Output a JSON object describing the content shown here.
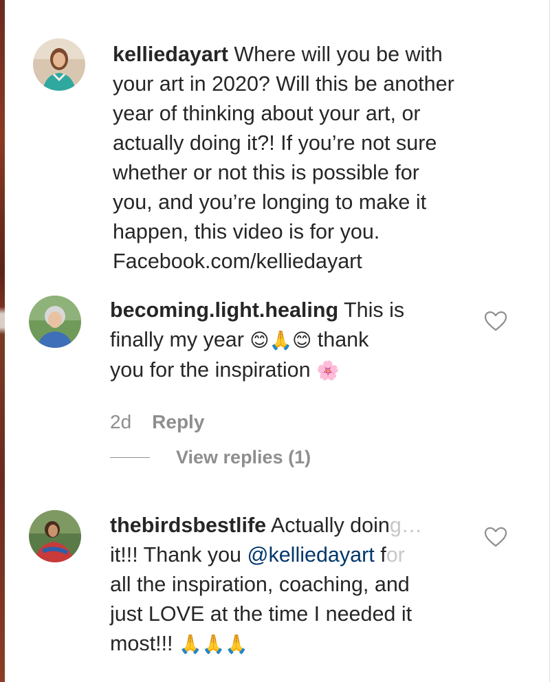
{
  "comments": [
    {
      "username": "kelliedayart",
      "lines": [
        " Where will you be with",
        "your art in 2020? Will this be another",
        "year of thinking about your art, or",
        "actually doing it?! If you’re not sure",
        "whether or not this is possible for",
        "you, and you’re longing to make it",
        "happen, this video is for you.",
        "Facebook.com/kelliedayart"
      ]
    },
    {
      "username": "becoming.light.healing",
      "line1": " This is",
      "line2_start": "finally my year ",
      "line2_emoji": "😊🙏😊",
      "line2_end": " thank",
      "line3_start": "you for the inspiration ",
      "line3_emoji": "🌸",
      "time": "2d",
      "reply_label": "Reply",
      "view_replies_label": "View replies (1)"
    },
    {
      "username": "thebirdsbestlife",
      "line1": " Actually doin",
      "line1_fade": "g…",
      "line2_start": "it!!! Thank you ",
      "mention": "@kelliedayart",
      "line2_end": " f",
      "line2_fade": "or",
      "line3": "all the inspiration, coaching, and",
      "line4": "just LOVE at the time I needed it",
      "line5_start": "most!!! ",
      "line5_emoji": "🙏🙏🙏"
    }
  ],
  "icons": {
    "like": "heart-outline-icon"
  },
  "colors": {
    "text": "#262626",
    "secondary": "#8e8e8e",
    "mention": "#00376b"
  }
}
